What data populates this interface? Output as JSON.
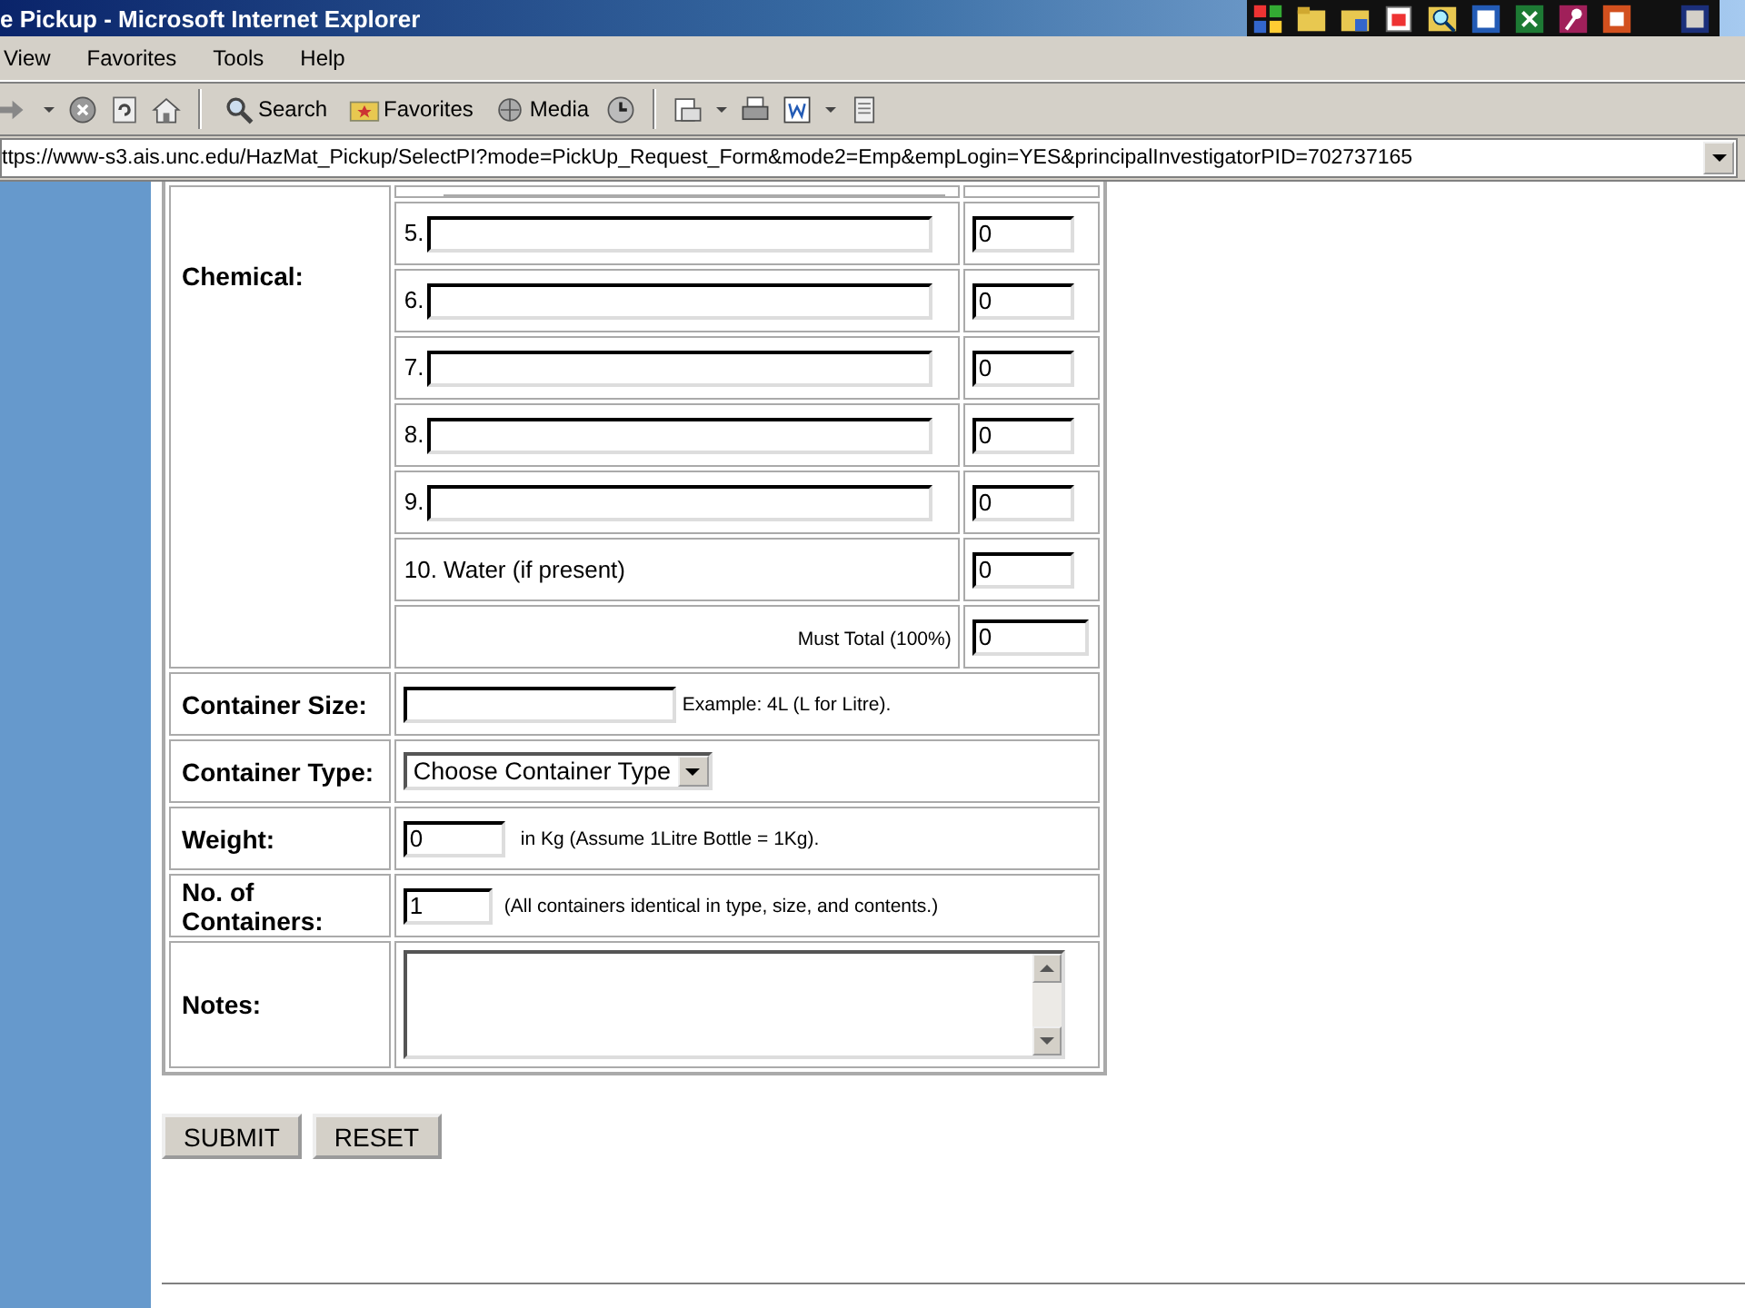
{
  "window": {
    "title": "e Pickup - Microsoft Internet Explorer"
  },
  "menu": [
    "View",
    "Favorites",
    "Tools",
    "Help"
  ],
  "toolbar": [
    {
      "kind": "forward"
    },
    {
      "kind": "caret"
    },
    {
      "kind": "stop"
    },
    {
      "kind": "refresh"
    },
    {
      "kind": "home"
    },
    {
      "kind": "separator"
    },
    {
      "kind": "search",
      "label": "Search"
    },
    {
      "kind": "favorites",
      "label": "Favorites"
    },
    {
      "kind": "media",
      "label": "Media"
    },
    {
      "kind": "history"
    },
    {
      "kind": "separator"
    },
    {
      "kind": "mail"
    },
    {
      "kind": "caret"
    },
    {
      "kind": "print"
    },
    {
      "kind": "edit"
    },
    {
      "kind": "caret"
    },
    {
      "kind": "discuss"
    }
  ],
  "address": {
    "value": "ttps://www-s3.ais.unc.edu/HazMat_Pickup/SelectPI?mode=PickUp_Request_Form&mode2=Emp&empLogin=YES&principalInvestigatorPID=702737165"
  },
  "chemical": {
    "label": "Chemical:",
    "rows": [
      {
        "kind": "input",
        "number": "5.",
        "percent": "0"
      },
      {
        "kind": "input",
        "number": "6.",
        "percent": "0"
      },
      {
        "kind": "input",
        "number": "7.",
        "percent": "0"
      },
      {
        "kind": "input",
        "number": "8.",
        "percent": "0"
      },
      {
        "kind": "input",
        "number": "9.",
        "percent": "0"
      },
      {
        "kind": "fixed",
        "label": "10. Water (if present)",
        "percent": "0"
      }
    ],
    "total": {
      "label": "Must Total (100%)",
      "value": "0"
    }
  },
  "fields": [
    {
      "kind": "text",
      "label": "Container Size:",
      "hint": "Example: 4L (L for Litre)."
    },
    {
      "kind": "select",
      "label": "Container Type:",
      "value": "Choose Container Type"
    },
    {
      "kind": "short",
      "label": "Weight:",
      "value": "0",
      "hint": "in Kg (Assume 1Litre Bottle = 1Kg)."
    },
    {
      "kind": "count",
      "label": "No. of Containers:",
      "value": "1",
      "hint": "(All containers identical in type, size, and contents.)"
    },
    {
      "kind": "textarea",
      "label": "Notes:"
    }
  ],
  "buttons": [
    "SUBMIT",
    "RESET"
  ]
}
